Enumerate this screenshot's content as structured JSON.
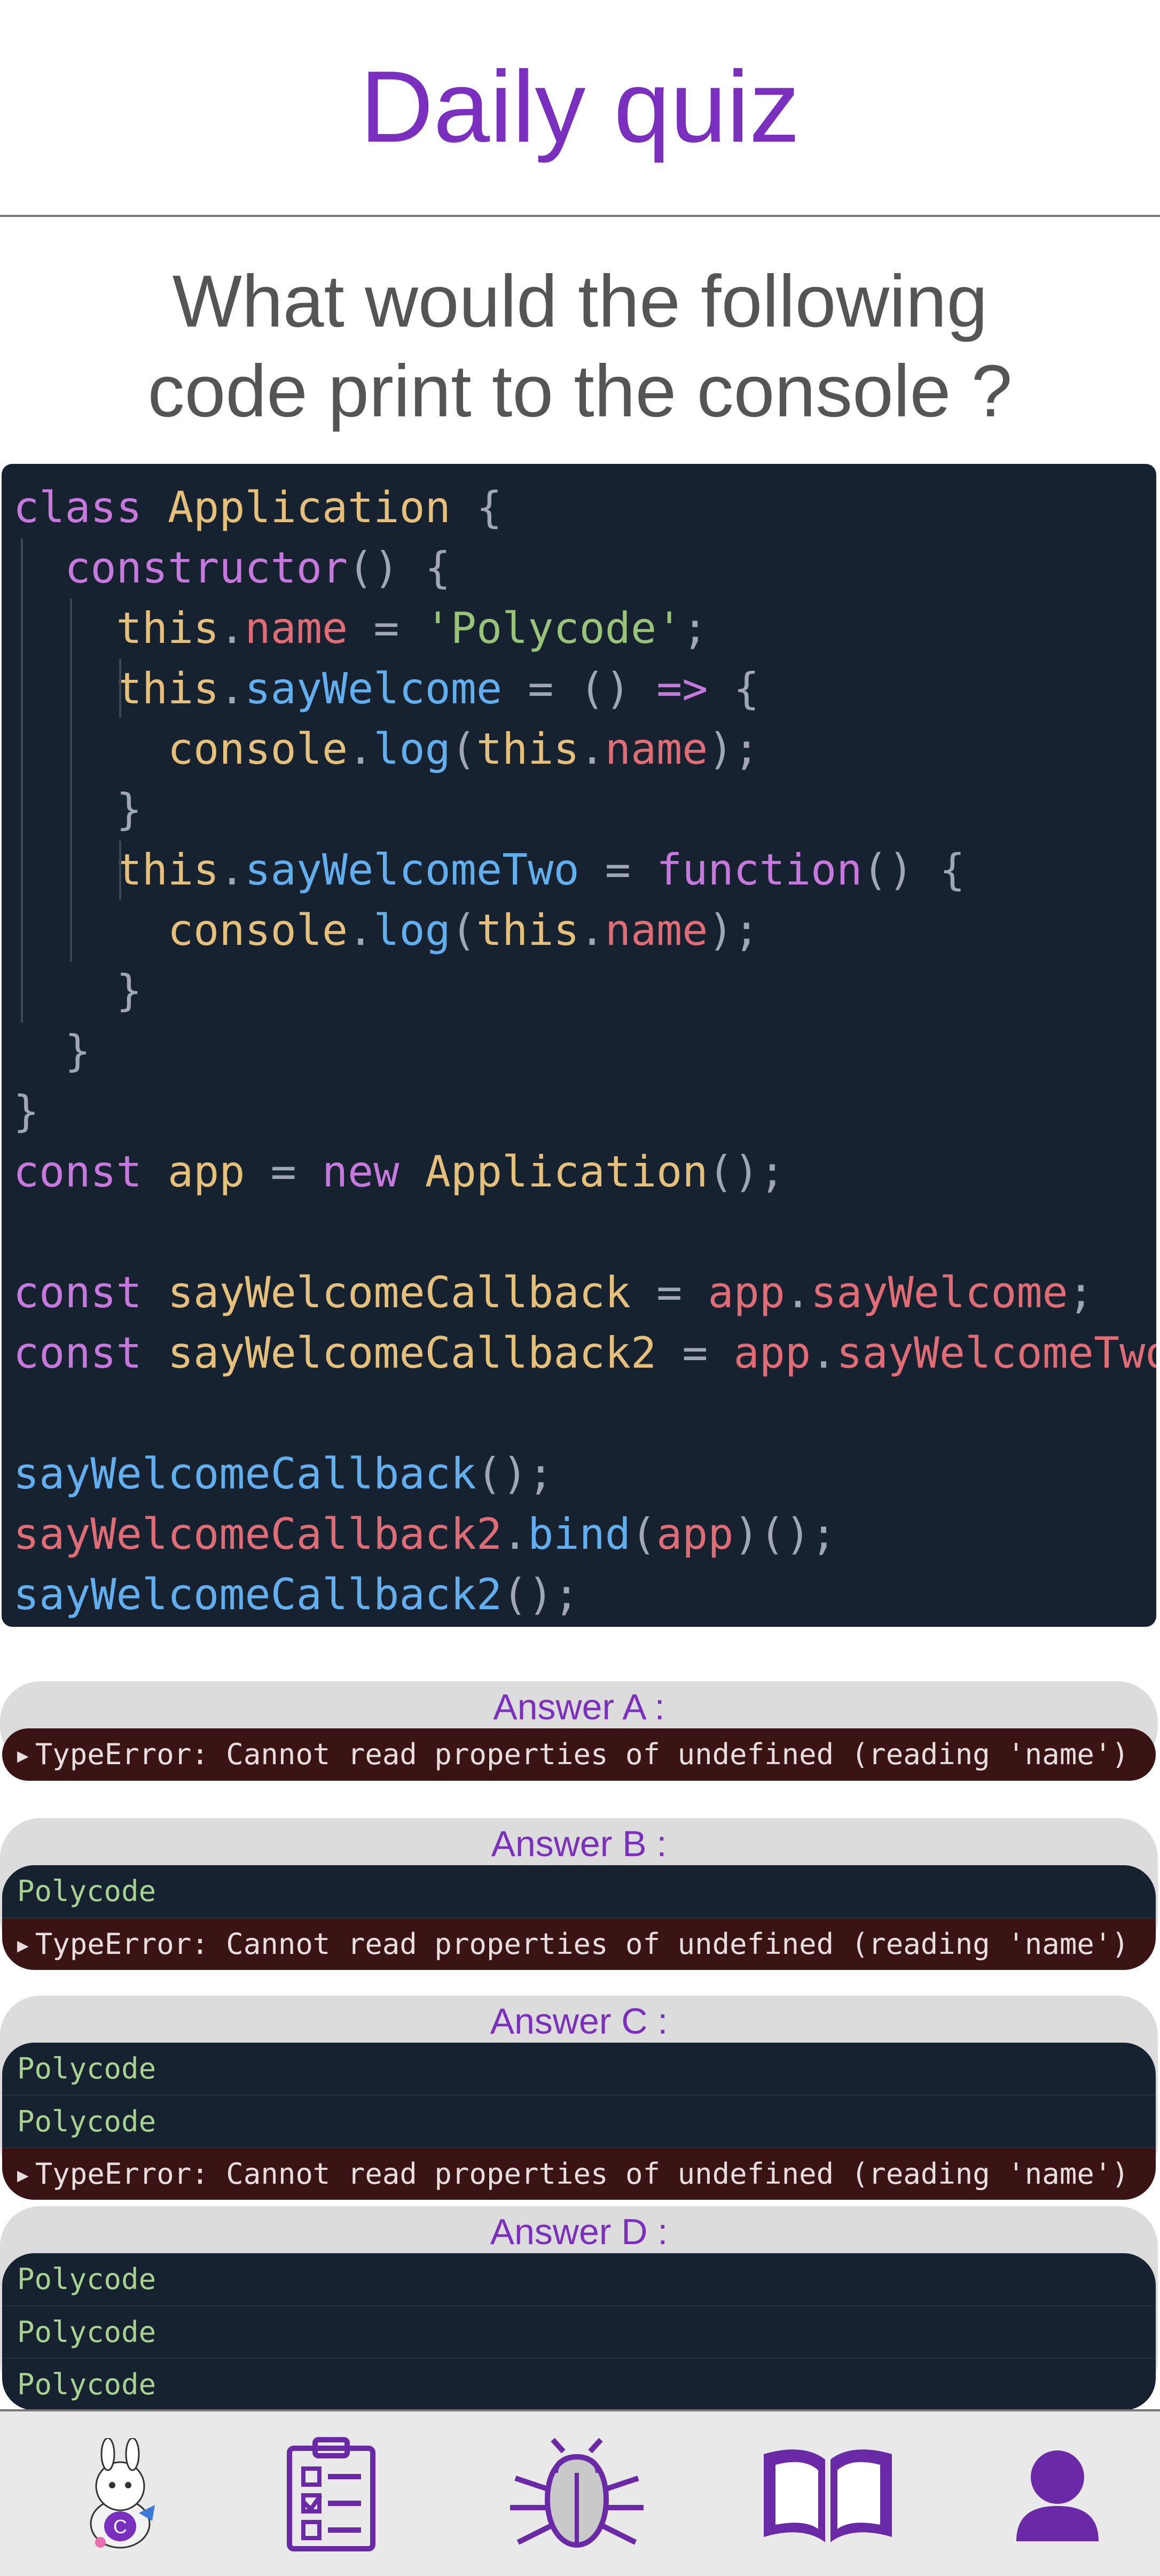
{
  "header": {
    "title": "Daily quiz"
  },
  "question": {
    "line1": "What would the following",
    "line2": "code print to the console ?"
  },
  "answers": [
    {
      "label": "Answer A :",
      "lines": [
        {
          "type": "error",
          "text": "TypeError: Cannot read properties of undefined (reading 'name')"
        }
      ]
    },
    {
      "label": "Answer B :",
      "lines": [
        {
          "type": "log",
          "text": "Polycode"
        },
        {
          "type": "error",
          "text": "TypeError: Cannot read properties of undefined (reading 'name')"
        }
      ]
    },
    {
      "label": "Answer C :",
      "lines": [
        {
          "type": "log",
          "text": "Polycode"
        },
        {
          "type": "log",
          "text": "Polycode"
        },
        {
          "type": "error",
          "text": "TypeError: Cannot read properties of undefined (reading 'name')"
        }
      ]
    },
    {
      "label": "Answer D :",
      "lines": [
        {
          "type": "log",
          "text": "Polycode"
        },
        {
          "type": "log",
          "text": "Polycode"
        },
        {
          "type": "log",
          "text": "Polycode"
        }
      ]
    }
  ],
  "nav": {
    "items": [
      {
        "name": "mascot-icon"
      },
      {
        "name": "checklist-icon"
      },
      {
        "name": "bug-icon"
      },
      {
        "name": "book-icon"
      },
      {
        "name": "profile-icon"
      }
    ]
  },
  "colors": {
    "accent": "#7b2fbf",
    "code_bg": "#172230",
    "error_bg": "#3a1414",
    "log_text": "#a8d28f"
  }
}
